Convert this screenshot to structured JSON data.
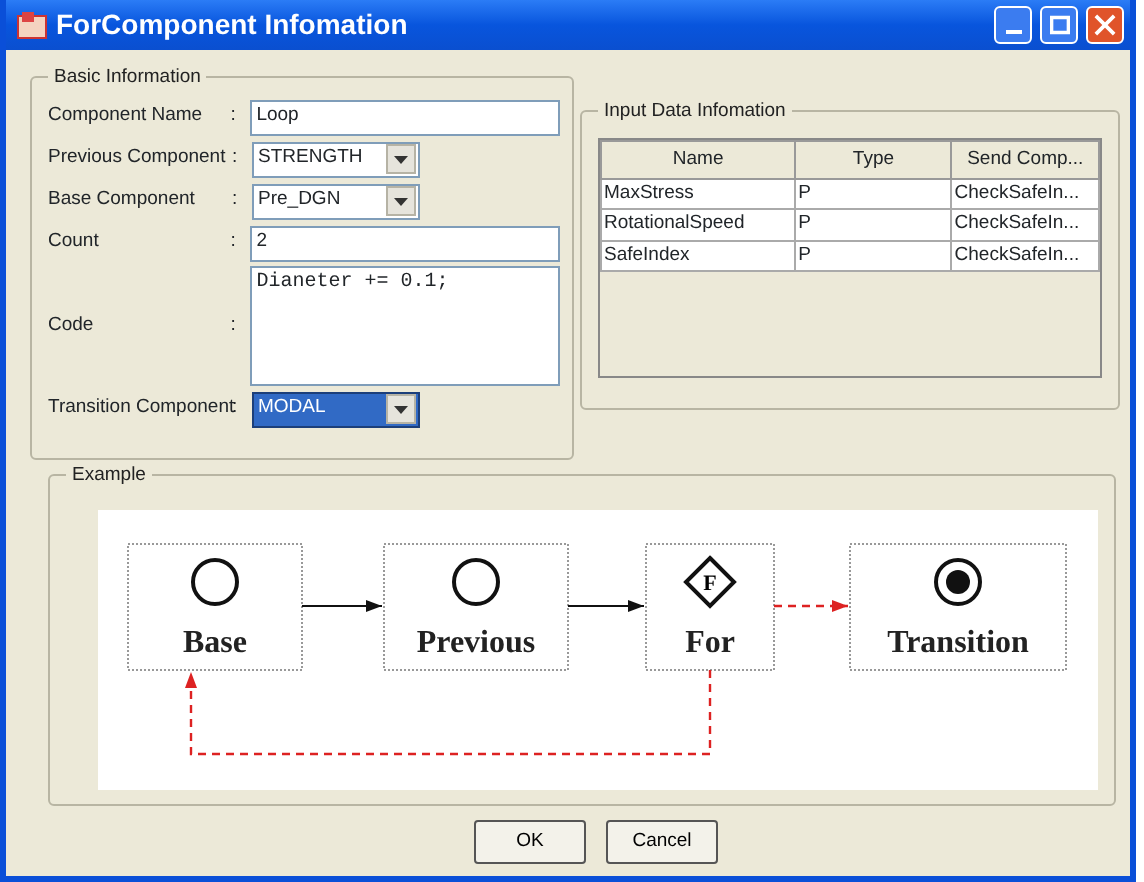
{
  "window": {
    "title": "ForComponent Infomation"
  },
  "basic_information": {
    "title": "Basic Information",
    "fields": [
      {
        "label": "Component Name",
        "separator": ":",
        "kind": "text",
        "value": "Loop"
      },
      {
        "label": "Previous Component",
        "separator": ":",
        "kind": "select",
        "value": "STRENGTH",
        "highlighted": false
      },
      {
        "label": "Base Component",
        "separator": ":",
        "kind": "select",
        "value": "Pre_DGN",
        "highlighted": false
      },
      {
        "label": "Count",
        "separator": ":",
        "kind": "text",
        "value": "2"
      },
      {
        "label": "Code",
        "separator": ":",
        "kind": "textarea",
        "value": "Dianeter += 0.1;"
      },
      {
        "label": "Transition Component",
        "separator": ":",
        "kind": "select",
        "value": "MODAL",
        "highlighted": true
      }
    ]
  },
  "input_data": {
    "title": "Input Data Infomation",
    "columns": [
      "Name",
      "Type",
      "Send Comp..."
    ],
    "rows": [
      [
        "MaxStress",
        "P",
        "CheckSafeIn..."
      ],
      [
        "RotationalSpeed",
        "P",
        "CheckSafeIn..."
      ],
      [
        "SafeIndex",
        "P",
        "CheckSafeIn..."
      ]
    ]
  },
  "example": {
    "title": "Example",
    "nodes": [
      {
        "label": "Base",
        "kind": "circle"
      },
      {
        "label": "Previous",
        "kind": "circle"
      },
      {
        "label": "For",
        "kind": "diamond",
        "symbol": "F"
      },
      {
        "label": "Transition",
        "kind": "terminal"
      }
    ],
    "edges": [
      {
        "kind": "solid"
      },
      {
        "kind": "solid"
      },
      {
        "kind": "dashed"
      },
      {
        "kind": "loop"
      }
    ]
  },
  "buttons": [
    "OK",
    "Cancel"
  ]
}
